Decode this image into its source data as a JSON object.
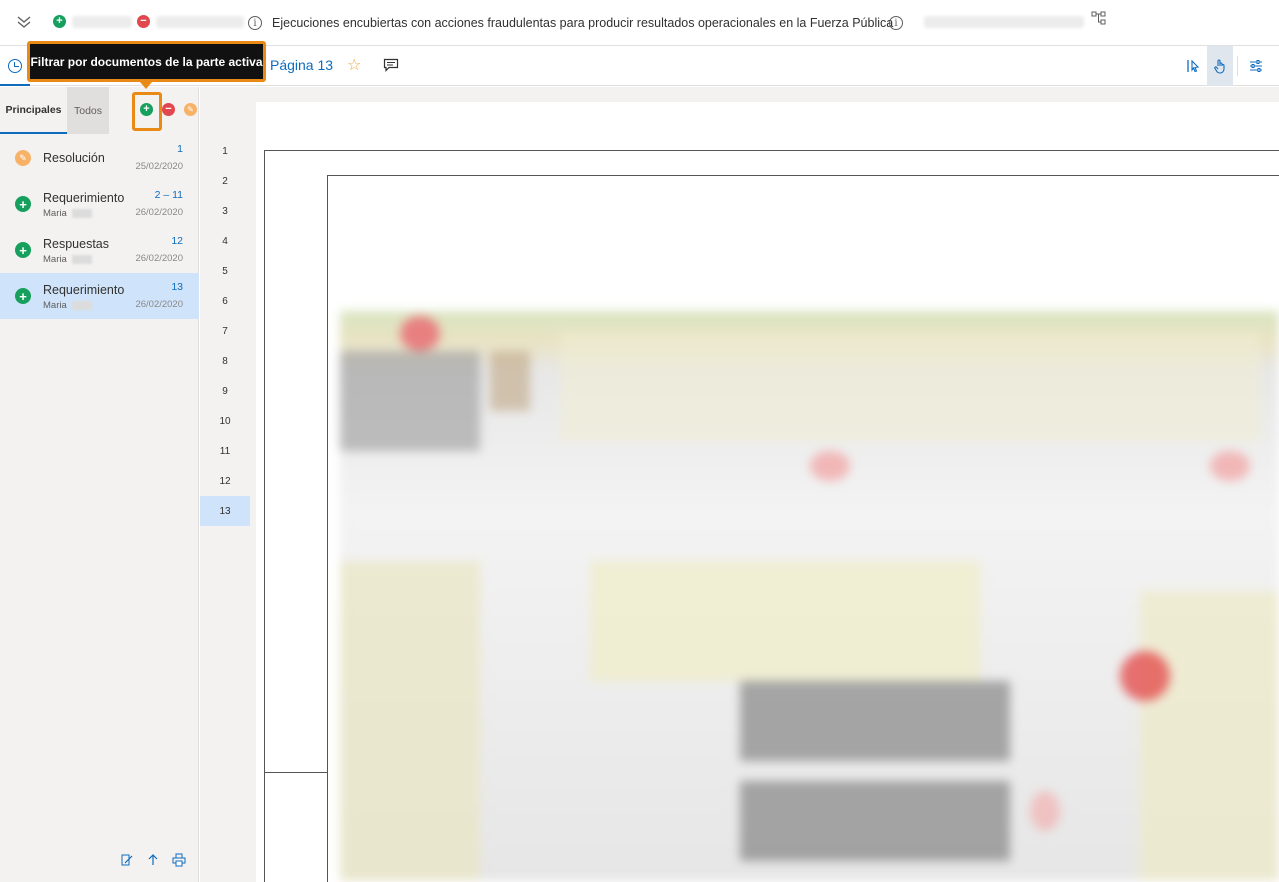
{
  "topbar": {
    "title": "Ejecuciones encubiertas con acciones fraudulentas para producir resultados operacionales en la Fuerza Pública"
  },
  "toolbar": {
    "page_label": "Página 13"
  },
  "tooltip": {
    "text": "Filtrar por documentos de la parte activa"
  },
  "sidebar": {
    "tabs": [
      {
        "label": "Principales",
        "active": true
      },
      {
        "label": "Todos",
        "active": false
      }
    ],
    "documents": [
      {
        "name": "Resolución",
        "author": "",
        "pages": "1",
        "date": "25/02/2020",
        "icon": "orange",
        "selected": false
      },
      {
        "name": "Requerimiento",
        "author": "Maria",
        "pages": "2 – 11",
        "date": "26/02/2020",
        "icon": "green",
        "selected": false
      },
      {
        "name": "Respuestas",
        "author": "Maria",
        "pages": "12",
        "date": "26/02/2020",
        "icon": "green",
        "selected": false
      },
      {
        "name": "Requerimiento",
        "author": "Maria",
        "pages": "13",
        "date": "26/02/2020",
        "icon": "green",
        "selected": true
      }
    ]
  },
  "page_numbers": [
    "1",
    "2",
    "3",
    "4",
    "5",
    "6",
    "7",
    "8",
    "9",
    "10",
    "11",
    "12",
    "13"
  ],
  "selected_page": "13",
  "colors": {
    "accent": "#0f6cbd",
    "active_party": "#17a05d",
    "passive_party": "#e0484e",
    "third_party": "#f7b267",
    "tooltip_border": "#e98a16",
    "selection": "#cfe4fa"
  }
}
